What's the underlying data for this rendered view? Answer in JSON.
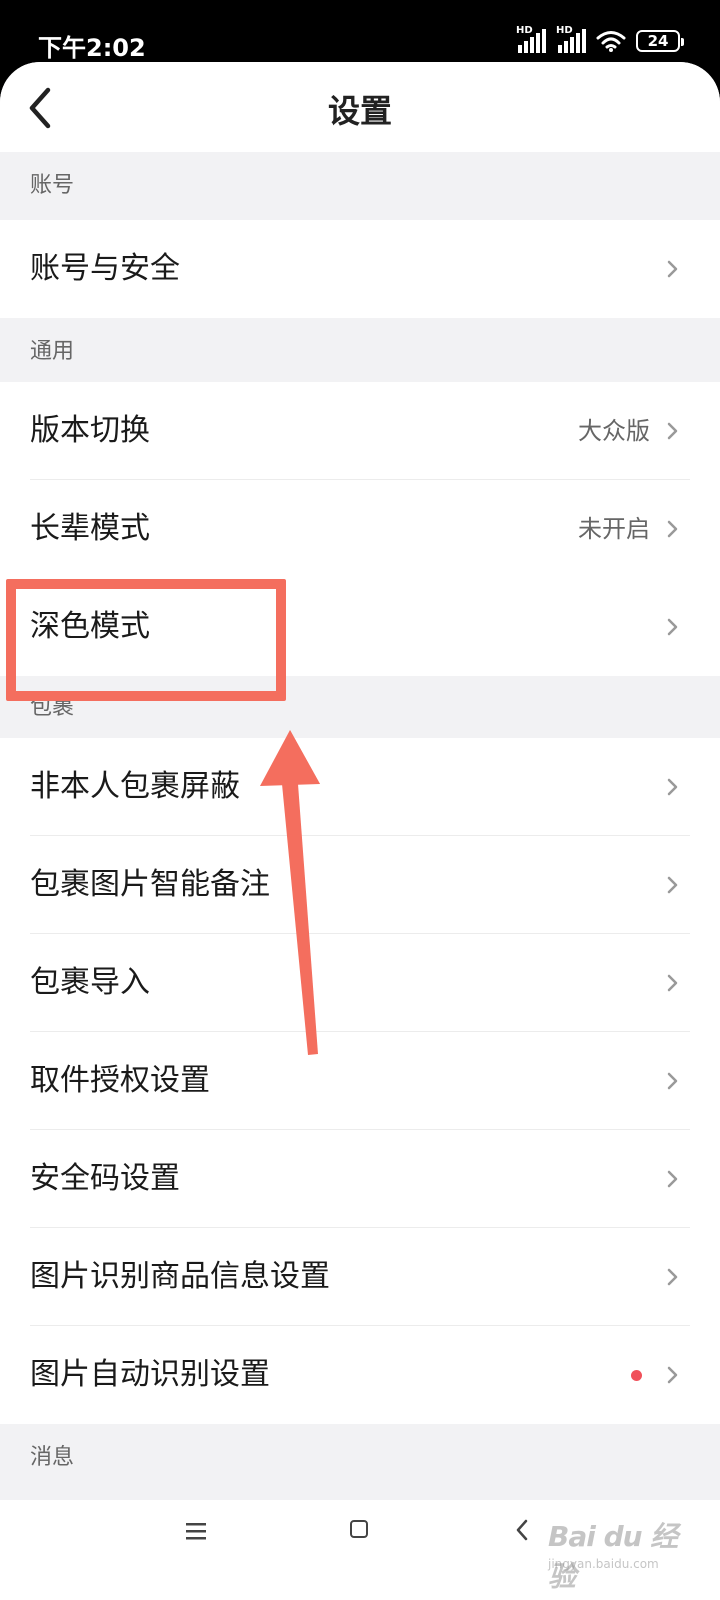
{
  "status_bar": {
    "time": "下午2:02",
    "signal1_label": "HD",
    "signal2_label": "HD",
    "battery": "24"
  },
  "header": {
    "title": "设置",
    "back_icon": "chevron-left-icon"
  },
  "sections": {
    "account": {
      "title": "账号",
      "items": [
        {
          "label": "账号与安全"
        }
      ]
    },
    "general": {
      "title": "通用",
      "items": [
        {
          "label": "版本切换",
          "value": "大众版"
        },
        {
          "label": "长辈模式",
          "value": "未开启"
        },
        {
          "label": "深色模式"
        }
      ]
    },
    "package": {
      "title": "包裹",
      "items": [
        {
          "label": "非本人包裹屏蔽"
        },
        {
          "label": "包裹图片智能备注"
        },
        {
          "label": "包裹导入"
        },
        {
          "label": "取件授权设置"
        },
        {
          "label": "安全码设置"
        },
        {
          "label": "图片识别商品信息设置"
        },
        {
          "label": "图片自动识别设置",
          "badge": "red-dot"
        }
      ]
    },
    "message": {
      "title": "消息"
    }
  },
  "nav_bar": {
    "menu_icon": "menu-icon",
    "home_icon": "home-icon",
    "back_icon": "back-icon"
  },
  "watermark": {
    "logo": "Bai du 经验",
    "url": "jingyan.baidu.com"
  },
  "colors": {
    "annotation": "#f46e5e",
    "badge": "#f0505a",
    "background": "#f2f2f4"
  }
}
